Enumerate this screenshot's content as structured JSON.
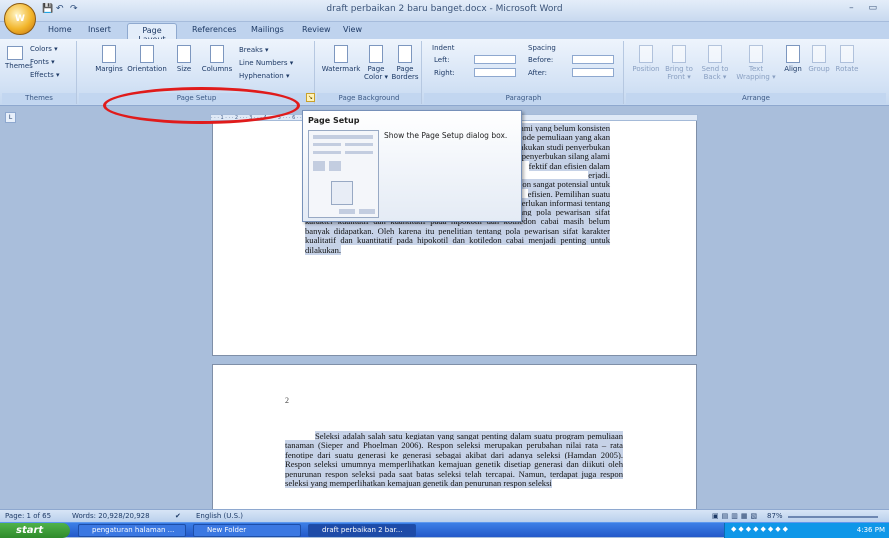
{
  "title": "draft perbaikan 2 baru banget.docx - Microsoft Word",
  "office_button": "W",
  "window_controls": "– ▭",
  "tabs": [
    "Home",
    "Insert",
    "Page Layout",
    "References",
    "Mailings",
    "Review",
    "View"
  ],
  "active_tab": "Page Layout",
  "themes": {
    "themes": "Themes",
    "colors": "Colors ▾",
    "fonts": "Fonts ▾",
    "effects": "Effects ▾",
    "group": "Themes"
  },
  "page_setup": {
    "margins": "Margins",
    "orientation": "Orientation",
    "size": "Size",
    "columns": "Columns",
    "breaks": "Breaks ▾",
    "line_numbers": "Line Numbers ▾",
    "hyphenation": "Hyphenation ▾",
    "group": "Page Setup"
  },
  "page_background": {
    "watermark": "Watermark",
    "page_color": "Page Color ▾",
    "page_borders": "Page Borders",
    "group": "Page Background"
  },
  "paragraph": {
    "indent": "Indent",
    "left": "Left:",
    "right": "Right:",
    "spacing": "Spacing",
    "before": "Before:",
    "after": "After:",
    "group": "Paragraph"
  },
  "arrange": {
    "position": "Position",
    "bring_to_front": "Bring to Front ▾",
    "send_to_back": "Send to Back ▾",
    "text_wrapping": "Text Wrapping ▾",
    "align": "Align",
    "group_btn": "Group",
    "rotate": "Rotate",
    "group": "Arrange"
  },
  "tooltip": {
    "title": "Page Setup",
    "description": "Show the Page Setup dialog box."
  },
  "page1_lines": [
    "ami yang belum konsisten",
    "ode pemuliaan yang akan",
    "akukan studi penyerbukan",
    "penyerbukan silang alami",
    "fektif dan efisien dalam",
    "erjadi.",
    "on sangat potensial untuk",
    "efisien. Pemilihan suatu",
    "erlukan informasi tentang"
  ],
  "page1_paragraph": "pola pewarisan sifat dari karakter tersebut. Informasi tentang pola pewarisan sifat karakter kualitatif dan kuantitatif pada hipokotil dan kotiledon cabai masih belum banyak didapatkan. Oleh karena itu penelitian tentang pola pewarisan sifat karakter kualitatif dan kuantitatif pada hipokotil dan kotiledon cabai menjadi penting untuk dilakukan.",
  "page2_number": "2",
  "page2_paragraph": "Seleksi adalah salah satu kegiatan yang sangat penting dalam suatu program pemuliaan tanaman (Sieper and Phoelman 2006). Respon seleksi merupakan perubahan nilai rata – rata fenotipe dari suatu generasi ke generasi sebagai akibat dari adanya seleksi (Hamdan 2005). Respon seleksi umumnya memperlihatkan kemajuan genetik disetiap generasi dan diikuti oleh penurunan respon seleksi pada saat batas seleksi telah tercapai. Namun, terdapat juga respon seleksi yang memperlihatkan kemajuan genetik dan penurunan respon seleksi",
  "status": {
    "page": "Page: 1 of 65",
    "words": "Words: 20,928/20,928",
    "language": "English (U.S.)",
    "zoom": "87%"
  },
  "taskbar": {
    "start": "start",
    "tasks": [
      "pengaturan halaman ...",
      "New Folder",
      "draft perbaikan 2 bar..."
    ],
    "clock": "4:36 PM"
  }
}
